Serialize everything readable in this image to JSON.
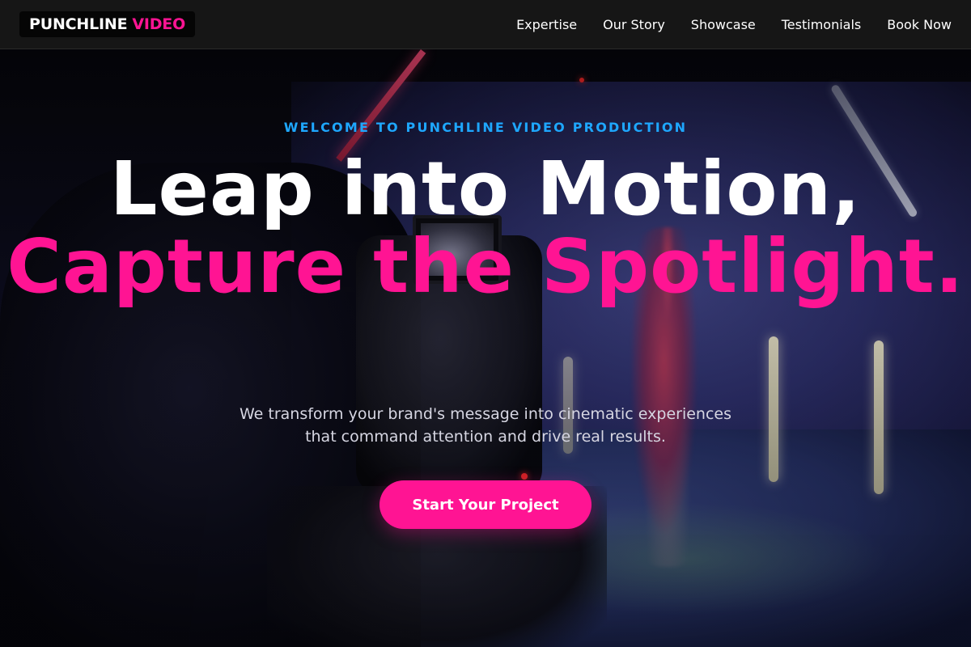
{
  "brand": {
    "name_part1": "PUNCHLINE",
    "name_part2": "VIDEO",
    "accent_color": "#ff1493"
  },
  "nav": {
    "items": [
      {
        "label": "Expertise"
      },
      {
        "label": "Our Story"
      },
      {
        "label": "Showcase"
      },
      {
        "label": "Testimonials"
      },
      {
        "label": "Book Now"
      }
    ]
  },
  "hero": {
    "eyebrow": "WELCOME TO PUNCHLINE VIDEO PRODUCTION",
    "eyebrow_color": "#1ea7ff",
    "headline_line1": "Leap into Motion,",
    "headline_line2": "Capture the Spotlight.",
    "subtext": "We transform your brand's message into cinematic experiences that command attention and drive real results.",
    "cta_label": "Start Your Project",
    "background_image": "film-set-camera-dancer-photo"
  }
}
